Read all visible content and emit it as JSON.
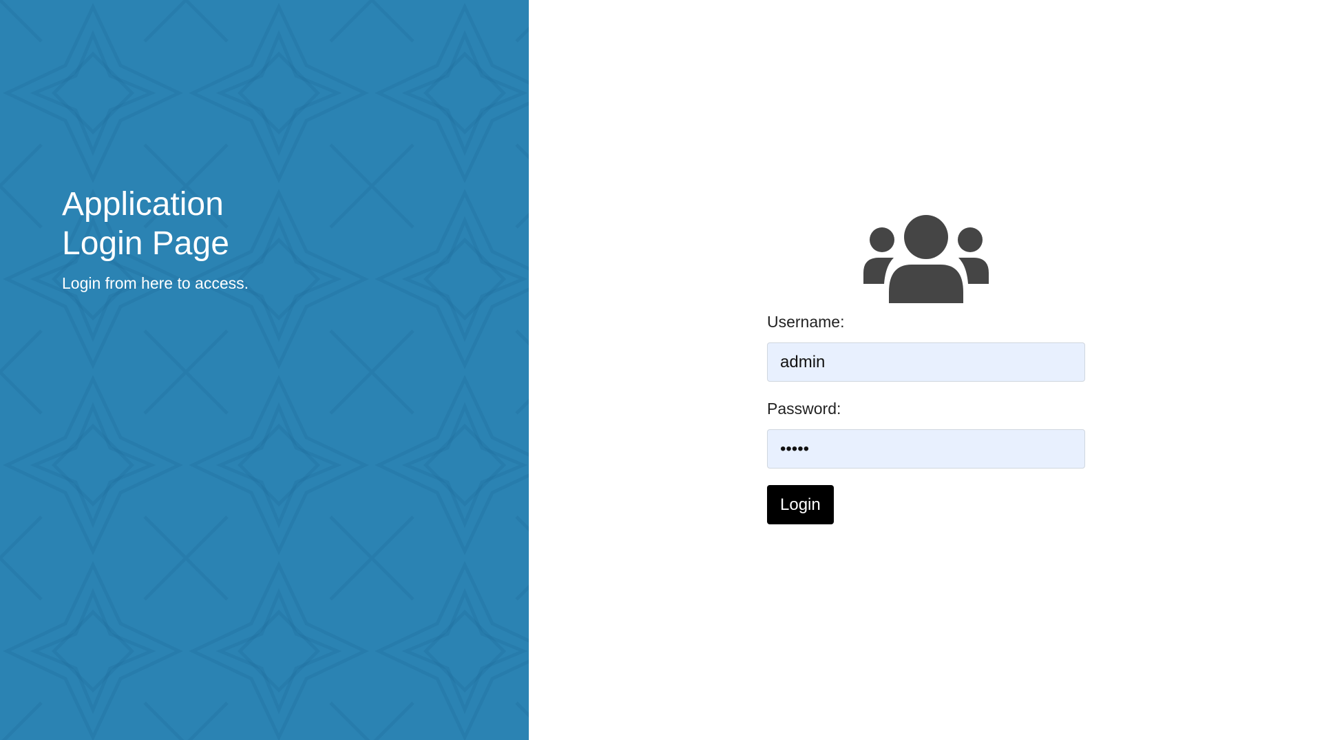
{
  "hero": {
    "title": "Application Login Page",
    "subtitle": "Login from here to access."
  },
  "form": {
    "icon": "users-icon",
    "username_label": "Username:",
    "username_value": "admin",
    "password_label": "Password:",
    "password_value": "•••••",
    "login_label": "Login"
  },
  "colors": {
    "panel_blue": "#2b83b3",
    "input_bg": "#e8f0fe",
    "button_bg": "#000000",
    "icon_color": "#454545"
  }
}
